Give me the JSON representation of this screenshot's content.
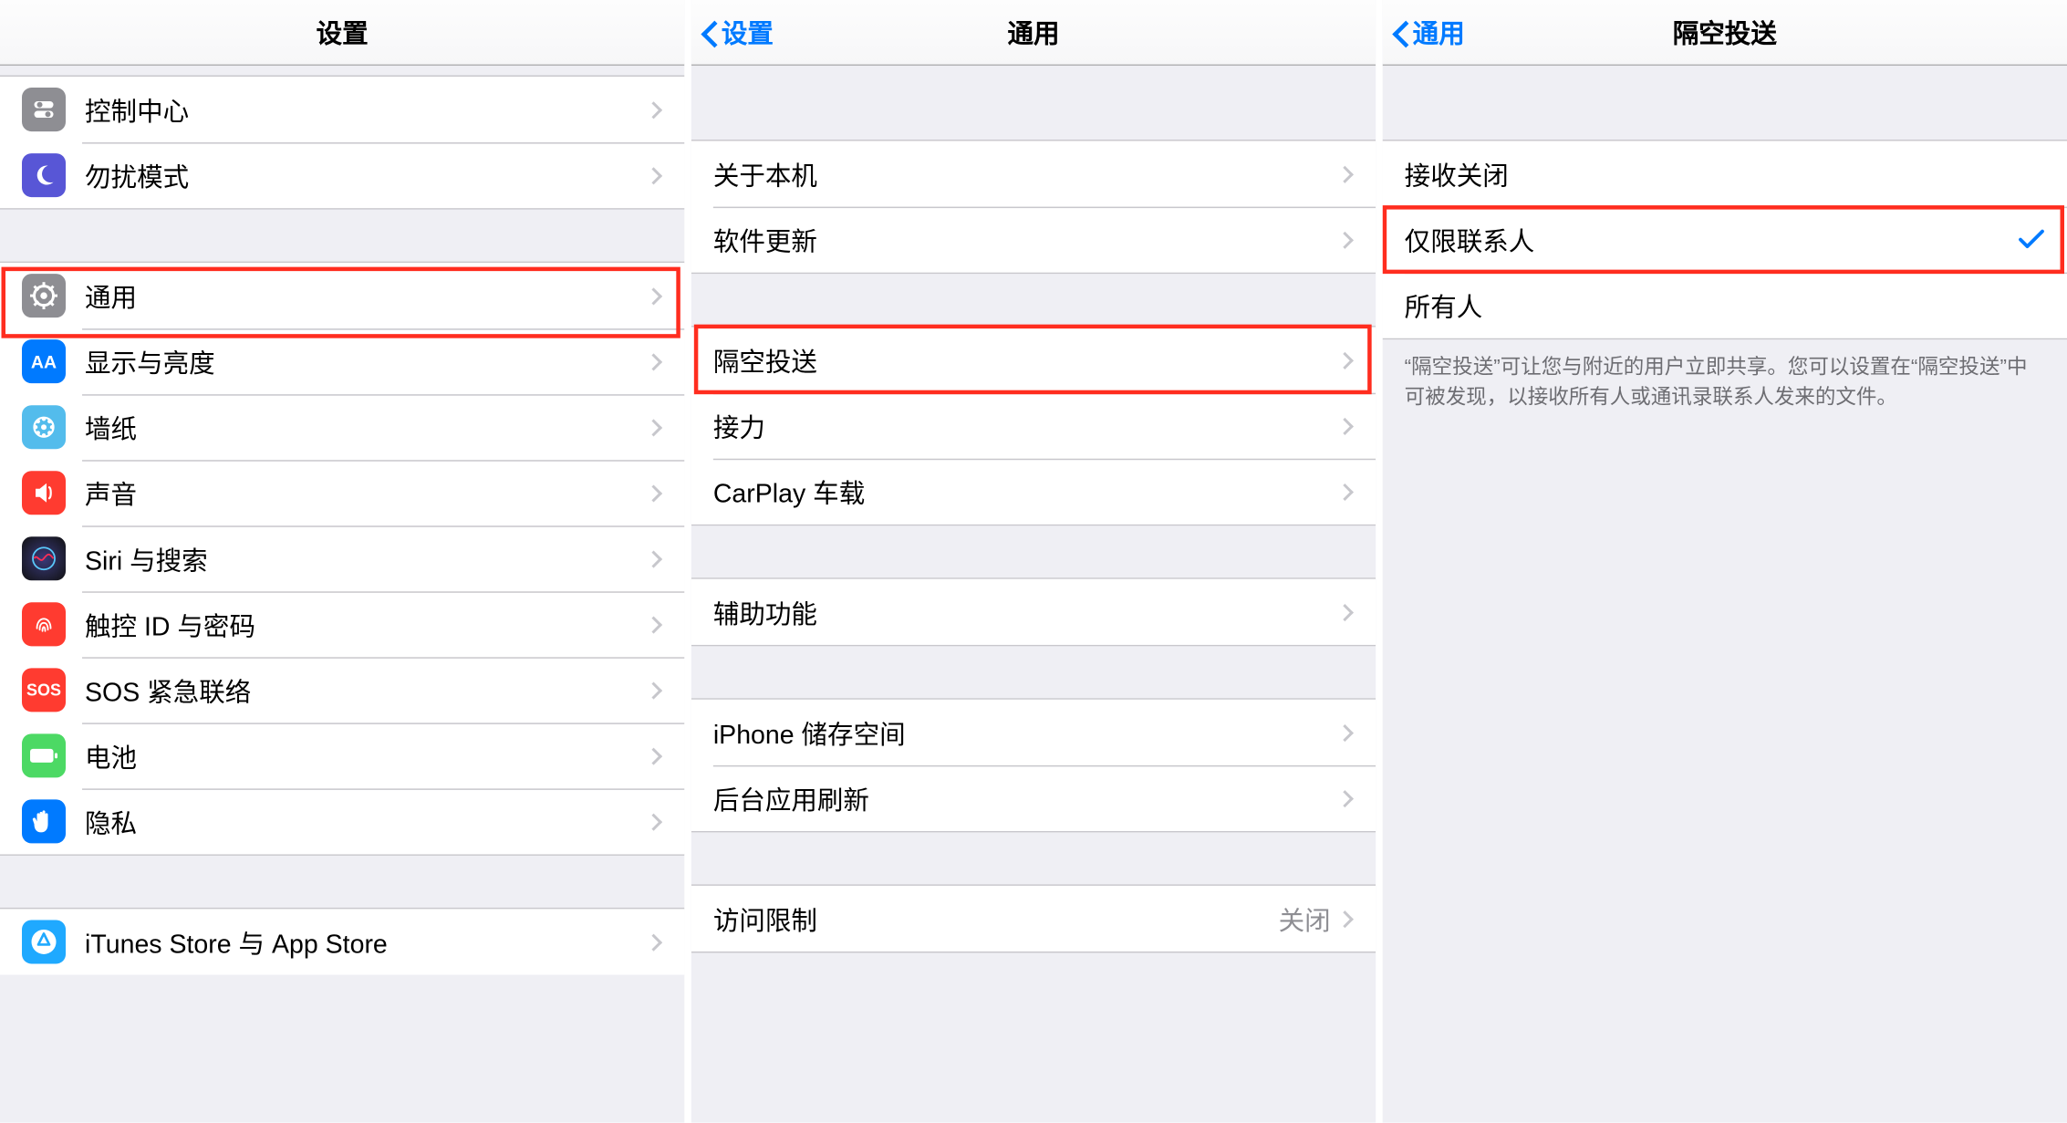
{
  "panel1": {
    "nav_title": "设置",
    "group1": [
      {
        "icon": "toggle",
        "label": "控制中心"
      },
      {
        "icon": "moon",
        "label": "勿扰模式"
      }
    ],
    "group2": [
      {
        "icon": "gear",
        "label": "通用",
        "highlight": true
      },
      {
        "icon": "display",
        "icon_text": "AA",
        "label": "显示与亮度"
      },
      {
        "icon": "wallpaper",
        "label": "墙纸"
      },
      {
        "icon": "sound",
        "label": "声音"
      },
      {
        "icon": "siri",
        "label": "Siri 与搜索"
      },
      {
        "icon": "touchid",
        "label": "触控 ID 与密码"
      },
      {
        "icon": "sos",
        "icon_text": "SOS",
        "label": "SOS 紧急联络"
      },
      {
        "icon": "battery",
        "label": "电池"
      },
      {
        "icon": "privacy",
        "label": "隐私"
      }
    ],
    "group3": [
      {
        "icon": "store",
        "label": "iTunes Store 与 App Store"
      }
    ]
  },
  "panel2": {
    "nav_back": "设置",
    "nav_title": "通用",
    "g1": [
      {
        "label": "关于本机"
      },
      {
        "label": "软件更新"
      }
    ],
    "g2": [
      {
        "label": "隔空投送",
        "highlight": true
      },
      {
        "label": "接力"
      },
      {
        "label": "CarPlay 车载"
      }
    ],
    "g3": [
      {
        "label": "辅助功能"
      }
    ],
    "g4": [
      {
        "label": "iPhone 储存空间"
      },
      {
        "label": "后台应用刷新"
      }
    ],
    "g5": [
      {
        "label": "访问限制",
        "value": "关闭"
      }
    ]
  },
  "panel3": {
    "nav_back": "通用",
    "nav_title": "隔空投送",
    "options": [
      {
        "label": "接收关闭",
        "selected": false
      },
      {
        "label": "仅限联系人",
        "selected": true,
        "highlight": true
      },
      {
        "label": "所有人",
        "selected": false
      }
    ],
    "footer": "“隔空投送”可让您与附近的用户立即共享。您可以设置在“隔空投送”中可被发现，以接收所有人或通讯录联系人发来的文件。"
  }
}
